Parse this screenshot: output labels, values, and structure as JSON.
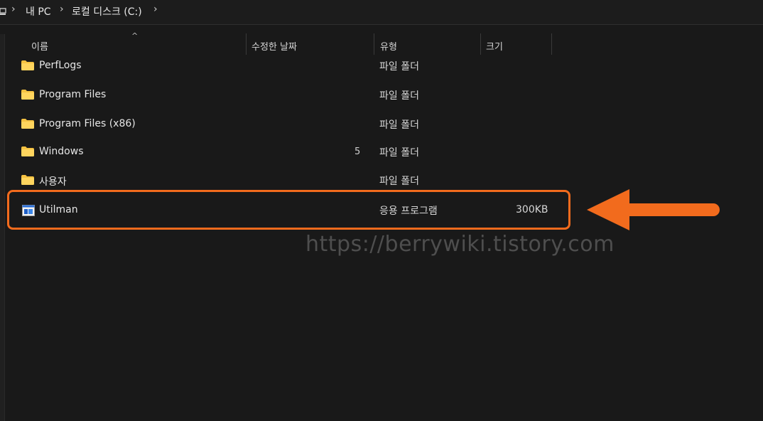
{
  "breadcrumb": {
    "items": [
      "내 PC",
      "로컬 디스크 (C:)"
    ],
    "separator": "›"
  },
  "columns": {
    "name": "이름",
    "modified": "수정한 날짜",
    "type": "유형",
    "size": "크기"
  },
  "rows": [
    {
      "name": "PerfLogs",
      "type": "파일 폴더",
      "size": "",
      "icon": "folder-icon"
    },
    {
      "name": "Program Files",
      "type": "파일 폴더",
      "size": "",
      "icon": "folder-icon"
    },
    {
      "name": "Program Files (x86)",
      "type": "파일 폴더",
      "size": "",
      "icon": "folder-icon"
    },
    {
      "name": "Windows",
      "type": "파일 폴더",
      "size": "",
      "icon": "folder-icon"
    },
    {
      "name": "사용자",
      "type": "파일 폴더",
      "size": "",
      "icon": "folder-icon"
    },
    {
      "name": "Utilman",
      "type": "응용 프로그램",
      "size": "300KB",
      "icon": "application-icon"
    }
  ],
  "watermark": "https://berrywiki.tistory.com",
  "stray_char": "5",
  "colors": {
    "background": "#191919",
    "highlight": "#f26b1d",
    "folder": "#f5c242"
  }
}
